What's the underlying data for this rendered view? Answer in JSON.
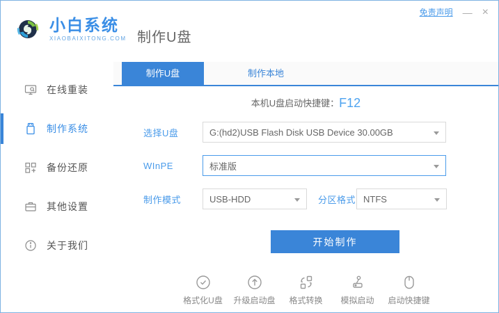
{
  "header": {
    "brand": "小白系统",
    "brand_domain": "XIAOBAIXITONG.COM",
    "page_title": "制作U盘",
    "disclaimer": "免责声明",
    "minimize": "—",
    "close": "×"
  },
  "sidebar": {
    "items": [
      {
        "label": "在线重装",
        "icon": "monitor-reinstall-icon",
        "active": false
      },
      {
        "label": "制作系统",
        "icon": "usb-make-icon",
        "active": true
      },
      {
        "label": "备份还原",
        "icon": "backup-grid-icon",
        "active": false
      },
      {
        "label": "其他设置",
        "icon": "briefcase-settings-icon",
        "active": false
      },
      {
        "label": "关于我们",
        "icon": "info-icon",
        "active": false
      }
    ]
  },
  "tabs": [
    {
      "label": "制作U盘",
      "active": true
    },
    {
      "label": "制作本地",
      "active": false
    }
  ],
  "main": {
    "hotkey_label": "本机U盘启动快捷键：",
    "hotkey_value": "F12",
    "fields": {
      "usb": {
        "label": "选择U盘",
        "value": "G:(hd2)USB Flash Disk USB Device 30.00GB"
      },
      "winpe": {
        "label": "WInPE",
        "value": "标准版"
      },
      "mode": {
        "label": "制作模式",
        "value": "USB-HDD"
      },
      "partition": {
        "label": "分区格式",
        "value": "NTFS"
      }
    },
    "start_button": "开始制作"
  },
  "footer": {
    "tools": [
      {
        "label": "格式化U盘",
        "icon": "format-check-icon"
      },
      {
        "label": "升级启动盘",
        "icon": "upgrade-arrow-icon"
      },
      {
        "label": "格式转换",
        "icon": "convert-icon"
      },
      {
        "label": "模拟启动",
        "icon": "joystick-icon"
      },
      {
        "label": "启动快捷键",
        "icon": "mouse-icon"
      }
    ]
  },
  "colors": {
    "accent": "#3a85d8",
    "label_blue": "#4a9bea",
    "hotkey_blue": "#4da3f0",
    "window_border": "#7db2e2"
  }
}
